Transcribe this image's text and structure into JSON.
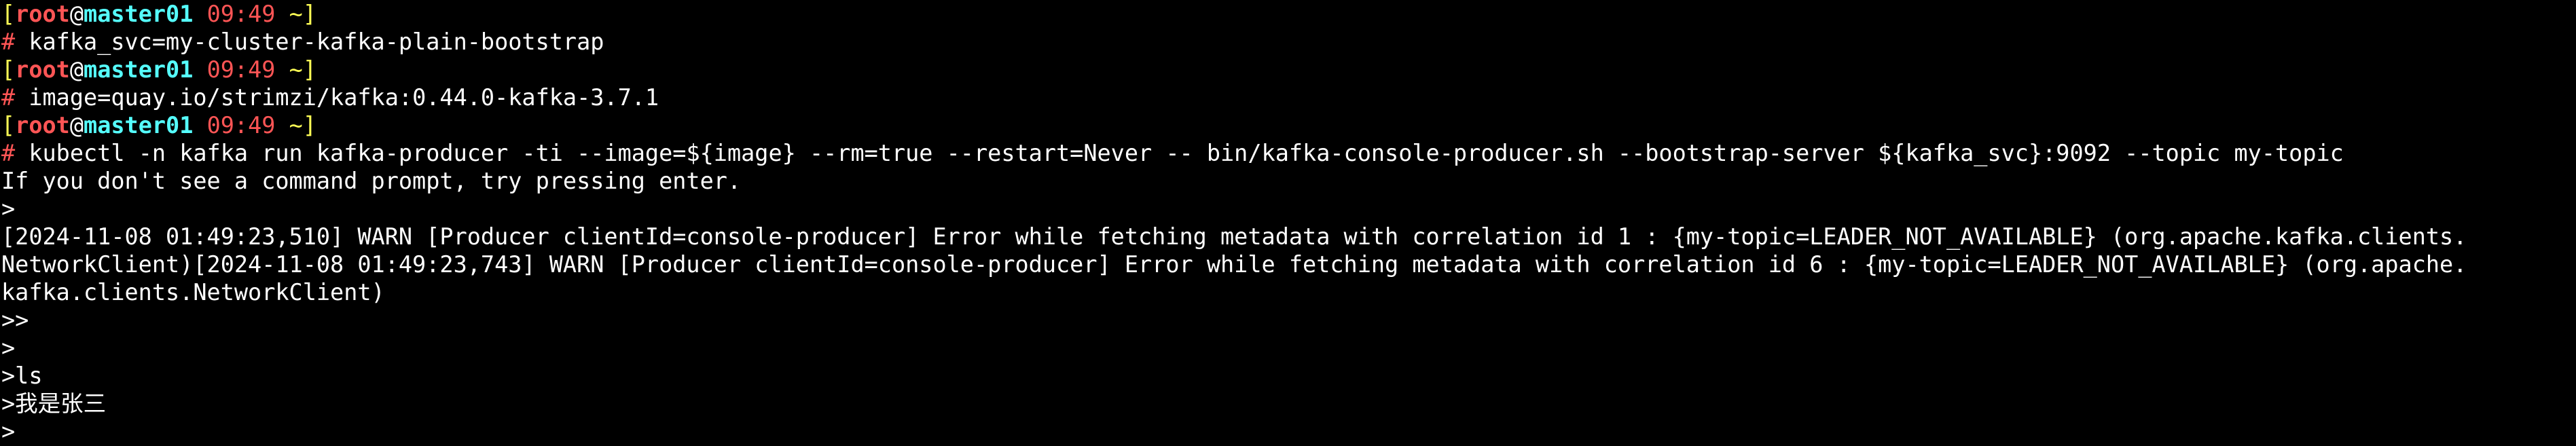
{
  "prompt": {
    "open_bracket": "[",
    "user": "root",
    "at": "@",
    "host": "master01",
    "time": "09:49",
    "dir": "~",
    "close_bracket": "]",
    "hash": "#"
  },
  "commands": [
    " kafka_svc=my-cluster-kafka-plain-bootstrap",
    " image=quay.io/strimzi/kafka:0.44.0-kafka-3.7.1",
    " kubectl -n kafka run kafka-producer -ti --image=${image} --rm=true --restart=Never -- bin/kafka-console-producer.sh --bootstrap-server ${kafka_svc}:9092 --topic my-topic"
  ],
  "output": [
    "If you don't see a command prompt, try pressing enter.",
    ">",
    "[2024-11-08 01:49:23,510] WARN [Producer clientId=console-producer] Error while fetching metadata with correlation id 1 : {my-topic=LEADER_NOT_AVAILABLE} (org.apache.kafka.clients.",
    "NetworkClient)[2024-11-08 01:49:23,743] WARN [Producer clientId=console-producer] Error while fetching metadata with correlation id 6 : {my-topic=LEADER_NOT_AVAILABLE} (org.apache.",
    "kafka.clients.NetworkClient)",
    ">>",
    ">",
    ">ls",
    ">我是张三",
    ">"
  ],
  "colors": {
    "background": "#000000",
    "foreground": "#ffffff",
    "prompt_user": "#ff5555",
    "prompt_host": "#55ffff",
    "prompt_bracket": "#ffff55",
    "prompt_hash": "#ff5555"
  }
}
